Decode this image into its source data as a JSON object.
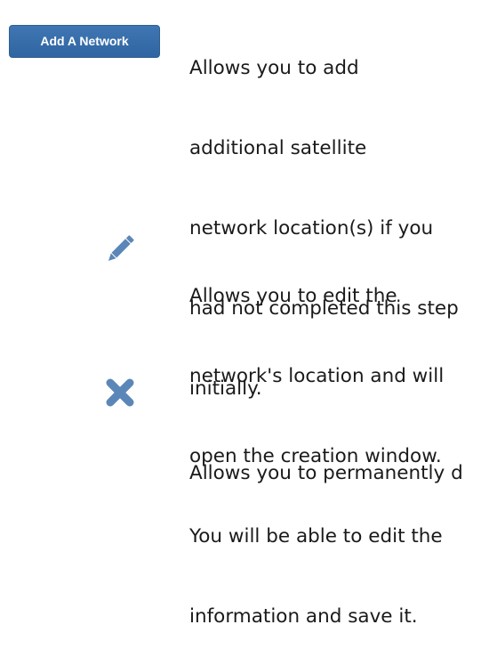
{
  "add_network": {
    "button_label": "Add A Network",
    "description_lines": [
      "Allows you to add",
      "additional satellite",
      "network location(s) if you",
      "had not completed this step",
      "initially."
    ]
  },
  "edit": {
    "icon": "pencil-icon",
    "icon_color": "#5b87b8",
    "description_lines": [
      "Allows you to edit the",
      "network's location and will",
      "open the creation window.",
      "You will be able to edit the",
      "information and save it."
    ]
  },
  "delete": {
    "icon": "close-x-icon",
    "icon_color": "#5b87b8",
    "description_lines": [
      "Allows you to permanently d"
    ]
  },
  "colors": {
    "button_bg": "#3a70ad",
    "button_text": "#ffffff",
    "body_text": "#1a1a1a"
  }
}
